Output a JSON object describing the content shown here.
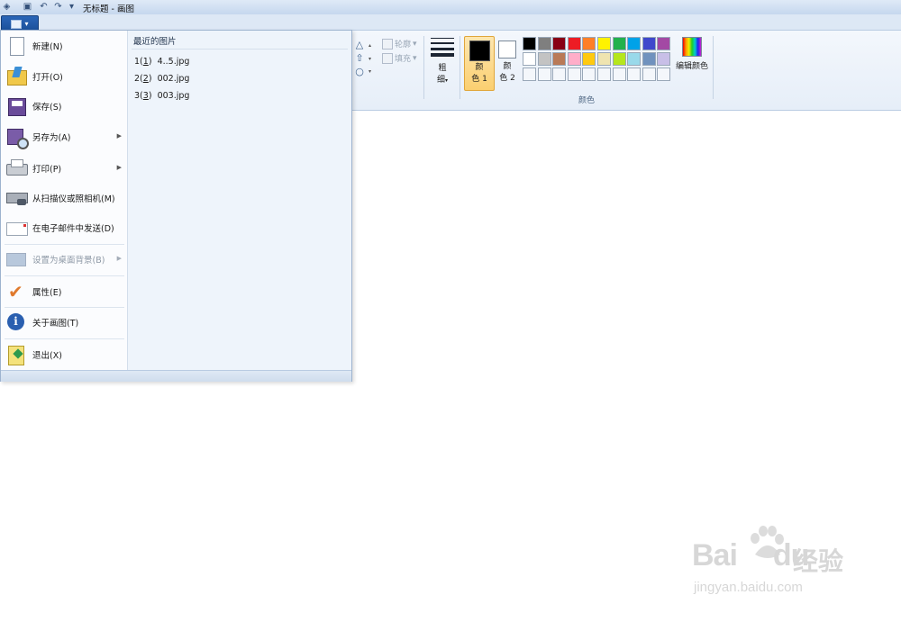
{
  "window": {
    "title": "无标题 - 画图"
  },
  "quick_access": {
    "icons": [
      "paint-app-icon",
      "save-icon",
      "undo-icon",
      "redo-icon",
      "customize-dropdown-icon"
    ]
  },
  "ribbon": {
    "file_button_icon": "file-menu-icon",
    "shapes_group": {
      "outline_label": "轮廓",
      "fill_label": "填充"
    },
    "size_label": "粗\n细",
    "size_label_top": "粗",
    "size_label_bottom": "细",
    "color1_label_top": "颜",
    "color1_label_bottom": "色 1",
    "color2_label_top": "颜",
    "color2_label_bottom": "色 2",
    "edit_colors_label": "编辑颜色",
    "colors_group_label": "颜色",
    "color1_value": "#000000",
    "color2_value": "#ffffff",
    "palette_row1": [
      "#000000",
      "#7f7f7f",
      "#880015",
      "#ed1c24",
      "#ff7f27",
      "#fff200",
      "#22b14c",
      "#00a2e8",
      "#3f48cc",
      "#a349a4"
    ],
    "palette_row2": [
      "#ffffff",
      "#c3c3c3",
      "#b97a57",
      "#ffaec9",
      "#ffc90e",
      "#efe4b0",
      "#b5e61d",
      "#99d9ea",
      "#7092be",
      "#c8bfe7"
    ],
    "palette_row3": [
      "#f4f7fb",
      "#f4f7fb",
      "#f4f7fb",
      "#f4f7fb",
      "#f4f7fb",
      "#f4f7fb",
      "#f4f7fb",
      "#f4f7fb",
      "#f4f7fb",
      "#f4f7fb"
    ]
  },
  "file_menu": {
    "items": [
      {
        "label": "新建(N)",
        "icon": "new-document-icon"
      },
      {
        "label": "打开(O)",
        "icon": "open-folder-icon"
      },
      {
        "label": "保存(S)",
        "icon": "save-disk-icon"
      },
      {
        "label": "另存为(A)",
        "icon": "save-as-icon",
        "submenu": true
      },
      {
        "label": "打印(P)",
        "icon": "printer-icon",
        "submenu": true
      },
      {
        "label": "从扫描仪或照相机(M)",
        "icon": "scanner-camera-icon"
      },
      {
        "label": "在电子邮件中发送(D)",
        "icon": "email-icon"
      },
      {
        "label": "设置为桌面背景(B)",
        "icon": "desktop-background-icon",
        "submenu": true,
        "disabled": true
      },
      {
        "label": "属性(E)",
        "icon": "properties-check-icon"
      },
      {
        "label": "关于画图(T)",
        "icon": "about-info-icon"
      },
      {
        "label": "退出(X)",
        "icon": "exit-icon"
      }
    ],
    "recent_title": "最近的图片",
    "recent": [
      {
        "index": "1",
        "key": "1",
        "name": "4..5.jpg"
      },
      {
        "index": "2",
        "key": "2",
        "name": "002.jpg"
      },
      {
        "index": "3",
        "key": "3",
        "name": "003.jpg"
      }
    ]
  },
  "watermark": {
    "brand": "Bai",
    "brand2": "du",
    "cn": "经验",
    "url": "jingyan.baidu.com"
  }
}
